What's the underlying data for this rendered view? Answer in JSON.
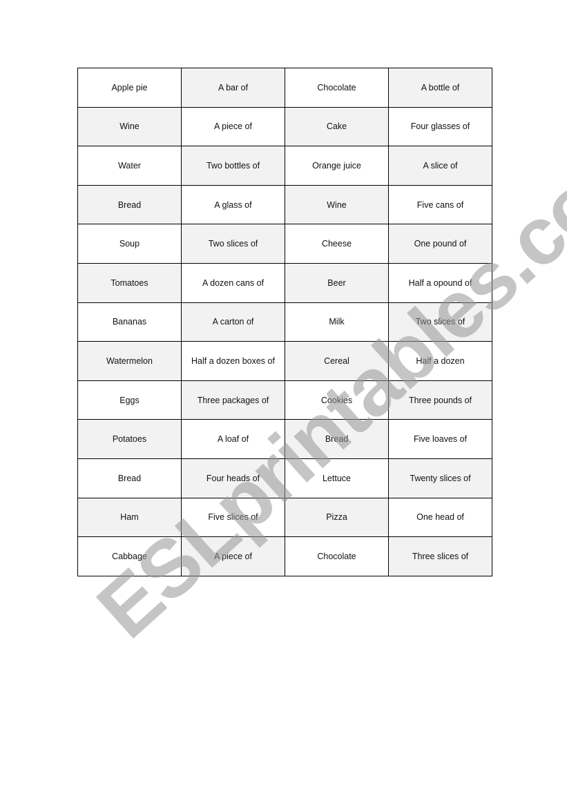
{
  "worksheet": {
    "rows": [
      [
        "Apple pie",
        "A bar of",
        "Chocolate",
        "A bottle of"
      ],
      [
        "Wine",
        "A piece of",
        "Cake",
        "Four glasses of"
      ],
      [
        "Water",
        "Two bottles of",
        "Orange juice",
        "A slice of"
      ],
      [
        "Bread",
        "A glass of",
        "Wine",
        "Five cans of"
      ],
      [
        "Soup",
        "Two slices of",
        "Cheese",
        "One pound of"
      ],
      [
        "Tomatoes",
        "A dozen cans of",
        "Beer",
        "Half a opound of"
      ],
      [
        "Bananas",
        "A carton of",
        "Milk",
        "Two slices of"
      ],
      [
        "Watermelon",
        "Half a dozen boxes of",
        "Cereal",
        "Half a dozen"
      ],
      [
        "Eggs",
        "Three packages of",
        "Cookies",
        "Three pounds of"
      ],
      [
        "Potatoes",
        "A loaf of",
        "Bread",
        "Five loaves of"
      ],
      [
        "Bread",
        "Four heads of",
        "Lettuce",
        "Twenty slices of"
      ],
      [
        "Ham",
        "Five slices of",
        "Pizza",
        "One head of"
      ],
      [
        "Cabbage",
        "A piece of",
        "Chocolate",
        "Three slices of"
      ]
    ],
    "shade_color": "#f2f2f2"
  },
  "watermark": {
    "text": "ESLprintables.com"
  }
}
